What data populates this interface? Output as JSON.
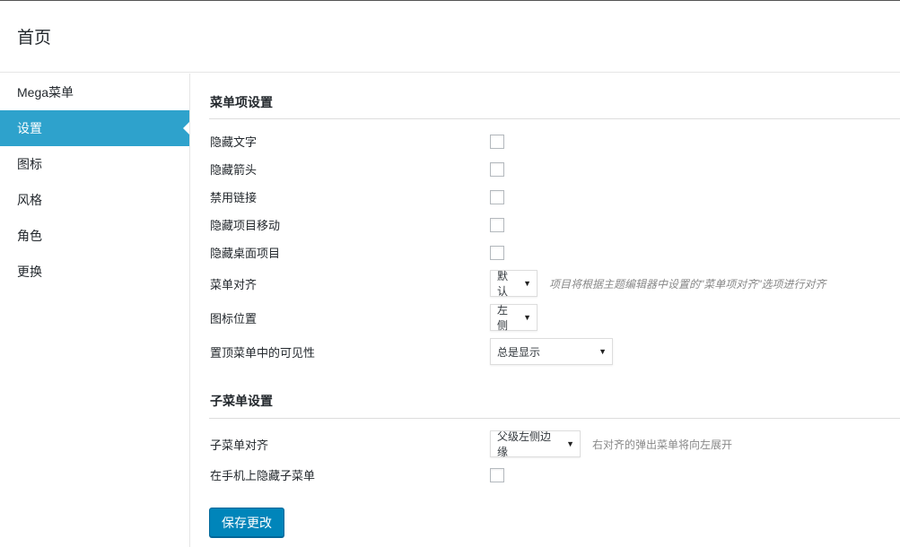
{
  "header": {
    "title": "首页"
  },
  "sidebar": {
    "items": [
      {
        "label": "Mega菜单"
      },
      {
        "label": "设置"
      },
      {
        "label": "图标"
      },
      {
        "label": "风格"
      },
      {
        "label": "角色"
      },
      {
        "label": "更换"
      }
    ],
    "active_index": 1
  },
  "menu_item_settings": {
    "title": "菜单项设置",
    "hide_text": {
      "label": "隐藏文字",
      "checked": false
    },
    "hide_arrow": {
      "label": "隐藏箭头",
      "checked": false
    },
    "disable_link": {
      "label": "禁用链接",
      "checked": false
    },
    "hide_on_mobile": {
      "label": "隐藏项目移动",
      "checked": false
    },
    "hide_on_desktop": {
      "label": "隐藏桌面项目",
      "checked": false
    },
    "menu_align": {
      "label": "菜单对齐",
      "value": "默认",
      "hint": "项目将根据主题编辑器中设置的\"菜单项对齐\"选项进行对齐"
    },
    "icon_position": {
      "label": "图标位置",
      "value": "左侧"
    },
    "sticky_visibility": {
      "label": "置顶菜单中的可见性",
      "value": "总是显示"
    }
  },
  "submenu_settings": {
    "title": "子菜单设置",
    "submenu_align": {
      "label": "子菜单对齐",
      "value": "父级左侧边缘",
      "hint": "右对齐的弹出菜单将向左展开"
    },
    "hide_submenu_mobile": {
      "label": "在手机上隐藏子菜单",
      "checked": false
    }
  },
  "actions": {
    "save_label": "保存更改"
  },
  "colors": {
    "accent": "#2ea2cc",
    "button": "#0085ba"
  }
}
